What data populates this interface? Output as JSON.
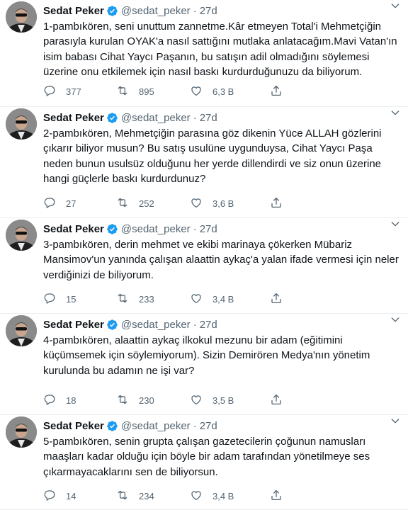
{
  "colors": {
    "verified": "#1d9bf0",
    "text": "#0f1419",
    "muted": "#536471",
    "divider": "#ebeef0"
  },
  "icons": {
    "verified": "verified-badge-icon",
    "more": "chevron-down-icon",
    "reply": "reply-icon",
    "retweet": "retweet-icon",
    "like": "like-icon",
    "share": "share-icon"
  },
  "tweets": [
    {
      "name": "Sedat Peker",
      "handle": "@sedat_peker",
      "sep": "·",
      "time": "27d",
      "text": "1-pambıkören, seni unuttum zannetme.Kâr etmeyen Total'i Mehmetçiğin parasıyla kurulan OYAK'a nasıl sattığını mutlaka anlatacağım.Mavi Vatan'ın isim babası Cihat Yaycı Paşanın, bu satışın adil olmadığını söylemesi üzerine onu etkilemek için nasıl baskı kurdurduğunuzu da biliyorum.",
      "replies": "377",
      "retweets": "895",
      "likes": "6,3 B"
    },
    {
      "name": "Sedat Peker",
      "handle": "@sedat_peker",
      "sep": "·",
      "time": "27d",
      "text": "2-pambıkören, Mehmetçiğin parasına göz dikenin Yüce ALLAH gözlerini çıkarır biliyor musun? Bu satış usulüne uygunduysa, Cihat Yaycı Paşa neden bunun usulsüz olduğunu her yerde dillendirdi ve siz onun üzerine hangi güçlerle baskı kurdurdunuz?",
      "replies": "27",
      "retweets": "252",
      "likes": "3,6 B"
    },
    {
      "name": "Sedat Peker",
      "handle": "@sedat_peker",
      "sep": "·",
      "time": "27d",
      "text": "3-pambıkören, derin mehmet ve ekibi marinaya çökerken Mübariz Mansimov'un yanında çalışan alaattin aykaç'a yalan ifade vermesi için neler verdiğinizi de biliyorum.",
      "replies": "15",
      "retweets": "233",
      "likes": "3,4 B"
    },
    {
      "name": "Sedat Peker",
      "handle": "@sedat_peker",
      "sep": "·",
      "time": "27d",
      "text": "4-pambıkören, alaattin aykaç ilkokul mezunu bir adam (eğitimini küçümsemek için söylemiyorum). Sizin Demirören Medya'nın yönetim kurulunda bu adamın ne işi var?",
      "replies": "18",
      "retweets": "230",
      "likes": "3,5 B"
    },
    {
      "name": "Sedat Peker",
      "handle": "@sedat_peker",
      "sep": "·",
      "time": "27d",
      "text": "5-pambıkören, senin grupta çalışan gazetecilerin çoğunun namusları maaşları kadar olduğu için böyle bir adam tarafından yönetilmeye ses çıkarmayacaklarını sen de biliyorsun.",
      "replies": "14",
      "retweets": "234",
      "likes": "3,4 B"
    }
  ]
}
